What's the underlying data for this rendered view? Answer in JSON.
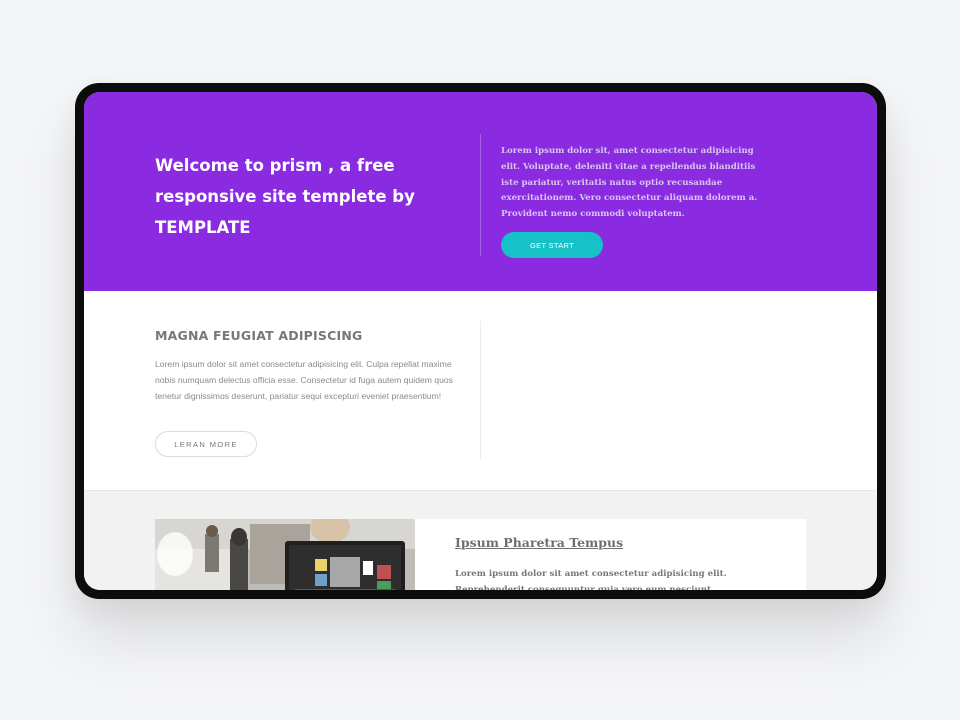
{
  "hero": {
    "title": "Welcome to prism , a free responsive site templete by TEMPLATE",
    "text": "Lorem ipsum dolor sit, amet consectetur adipisicing elit. Voluptate, deleniti vitae a repellendus blanditiis iste pariatur, veritatis natus optio recusandae exercitationem. Vero consectetur aliquam dolorem a. Provident nemo commodi voluptatem.",
    "button_label": "GET START",
    "background_color": "#8a2be2",
    "button_color": "#16c1c7"
  },
  "feature": {
    "heading": "MAGNA FEUGIAT ADIPISCING",
    "text": "Lorem ipsum dolor sit amet consectetur adipisicing elit. Culpa repellat maxime nobis numquam delectus officia esse. Consectetur id fuga autem quidem quos tenetur dignissimos deserunt, pariatur sequi excepturi eveniet praesentium!",
    "button_label": "LERAN MORE"
  },
  "card": {
    "title": "Ipsum Pharetra Tempus",
    "text": "Lorem ipsum dolor sit amet consectetur adipisicing elit. Reprehenderit consequuntur quia vero eum nesciunt"
  }
}
